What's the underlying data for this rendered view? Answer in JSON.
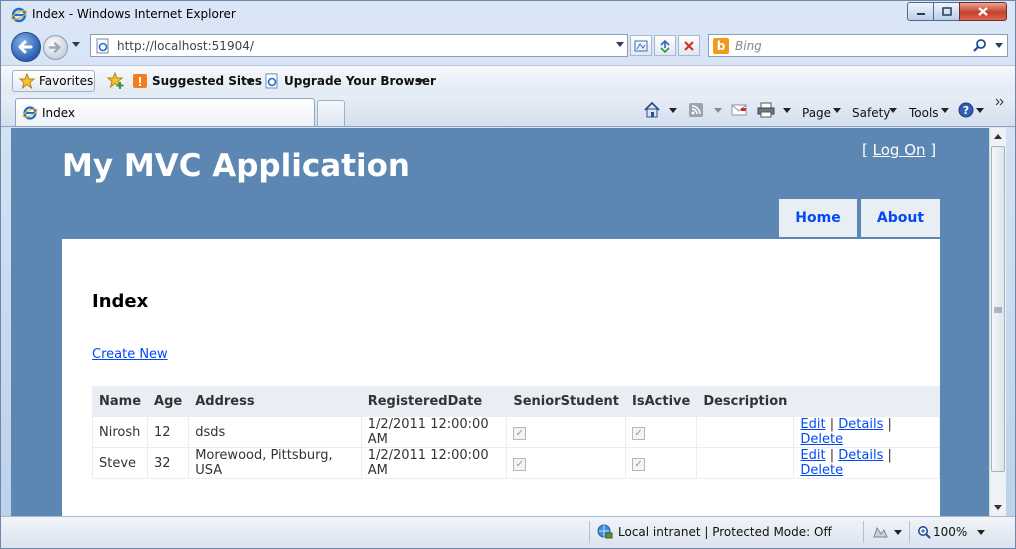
{
  "window": {
    "title": "Index - Windows Internet Explorer"
  },
  "address_bar": {
    "url": "http://localhost:51904/",
    "search_placeholder": "Bing"
  },
  "favorites_bar": {
    "favorites_label": "Favorites",
    "suggested_sites_label": "Suggested Sites",
    "upgrade_label": "Upgrade Your Browser"
  },
  "tabs": [
    {
      "label": "Index"
    }
  ],
  "command_bar": {
    "page_label": "Page",
    "safety_label": "Safety",
    "tools_label": "Tools"
  },
  "site": {
    "title": "My MVC Application",
    "logon_open": "[",
    "logon_label": "Log On",
    "logon_close": "]",
    "menu": [
      {
        "label": "Home"
      },
      {
        "label": "About"
      }
    ]
  },
  "main": {
    "heading": "Index",
    "create_new_label": "Create New",
    "table": {
      "headers": [
        "Name",
        "Age",
        "Address",
        "RegisteredDate",
        "SeniorStudent",
        "IsActive",
        "Description",
        ""
      ],
      "rows": [
        {
          "name": "Nirosh",
          "age": "12",
          "address": "dsds",
          "registered": "1/2/2011 12:00:00 AM",
          "senior": true,
          "active": true,
          "description": ""
        },
        {
          "name": "Steve",
          "age": "32",
          "address": "Morewood, Pittsburg, USA",
          "registered": "1/2/2011 12:00:00 AM",
          "senior": true,
          "active": true,
          "description": ""
        }
      ],
      "actions": {
        "edit": "Edit",
        "details": "Details",
        "delete": "Delete",
        "separator": "|"
      }
    }
  },
  "status_bar": {
    "zone": "Local intranet | Protected Mode: Off",
    "zoom": "100%"
  },
  "icons": {
    "back": "back-arrow-icon",
    "forward": "forward-arrow-icon",
    "refresh": "refresh-icon",
    "stop": "stop-icon",
    "home": "home-icon",
    "rss": "rss-feed-icon",
    "mail": "mail-icon",
    "print": "printer-icon",
    "help": "help-icon",
    "search": "magnifier-icon"
  }
}
